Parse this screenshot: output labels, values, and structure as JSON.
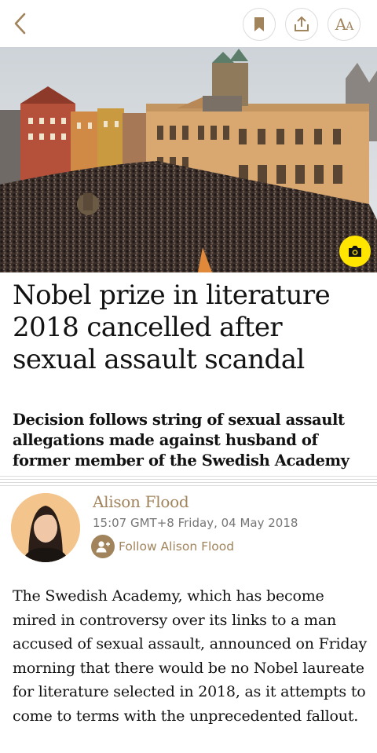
{
  "toolbar": {
    "back_icon": "chevron-left-icon",
    "bookmark_icon": "bookmark-icon",
    "share_icon": "share-icon",
    "font_size_label_big": "A",
    "font_size_label_small": "A"
  },
  "hero": {
    "camera_icon": "camera-icon",
    "accent_color": "#ffe500"
  },
  "article": {
    "headline": "Nobel prize in literature 2018 cancelled after sexual assault scandal",
    "standfirst": "Decision follows string of sexual assault allegations made against husband of former member of the Swedish Academy",
    "author": "Alison Flood",
    "timestamp": "15:07 GMT+8 Friday, 04 May 2018",
    "follow_label": "Follow Alison Flood",
    "body": "The Swedish Academy, which has become mired in controversy over its links to a man accused of sexual assault, announced on Friday morning that there would be no Nobel laureate for literature selected in 2018, as it attempts to come to terms with the unprecedented fallout."
  },
  "colors": {
    "brand_gold": "#a1845c",
    "text": "#121212",
    "meta_gray": "#767676"
  }
}
